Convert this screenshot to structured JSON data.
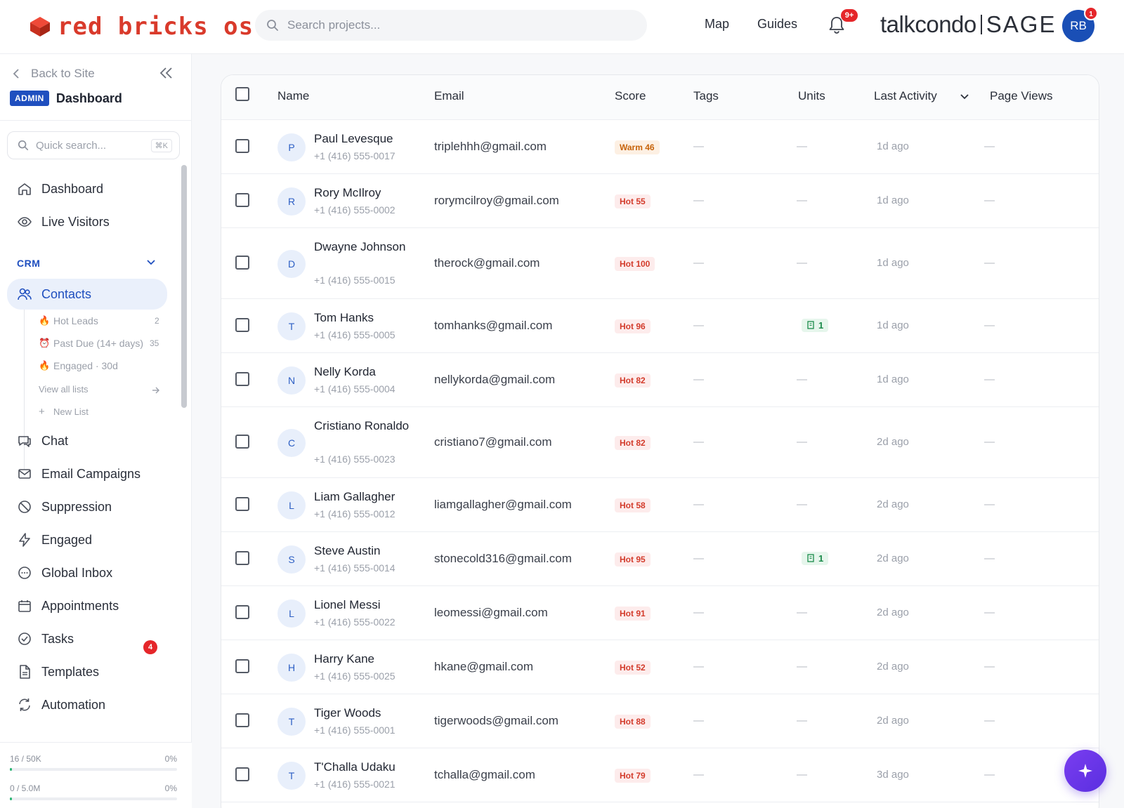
{
  "brand": {
    "name": "red bricks os",
    "partner_left": "talkcondo",
    "partner_right": "SAGE"
  },
  "search": {
    "placeholder": "Search projects..."
  },
  "topnav": {
    "map": "Map",
    "guides": "Guides",
    "notif_badge": "9+",
    "avatar_initials": "RB",
    "avatar_badge": "1"
  },
  "sidebar": {
    "back": "Back to Site",
    "admin_badge": "ADMIN",
    "title": "Dashboard",
    "quick_search_placeholder": "Quick search...",
    "quick_search_shortcut": "⌘K",
    "items_top": [
      {
        "label": "Dashboard",
        "icon": "home-icon"
      },
      {
        "label": "Live Visitors",
        "icon": "eye-icon"
      }
    ],
    "crm_label": "CRM",
    "contacts_label": "Contacts",
    "sublists": [
      {
        "label": "Hot Leads",
        "count": "2",
        "icon": "flame-icon"
      },
      {
        "label": "Past Due (14+ days)",
        "count": "35",
        "icon": "alarm-icon"
      },
      {
        "label": "Engaged · 30d",
        "count": "",
        "icon": "flame-icon"
      }
    ],
    "view_all": "View all lists",
    "new_list": "New List",
    "items_bottom": [
      {
        "label": "Chat",
        "icon": "chat-icon"
      },
      {
        "label": "Email Campaigns",
        "icon": "mail-icon"
      },
      {
        "label": "Suppression",
        "icon": "block-icon"
      },
      {
        "label": "Engaged",
        "icon": "bolt-icon"
      },
      {
        "label": "Global Inbox",
        "icon": "inbox-icon"
      },
      {
        "label": "Appointments",
        "icon": "calendar-icon"
      },
      {
        "label": "Tasks",
        "icon": "check-circle-icon"
      },
      {
        "label": "Templates",
        "icon": "document-icon"
      },
      {
        "label": "Automation",
        "icon": "refresh-icon"
      }
    ],
    "tasks_badge": "4",
    "usage": [
      {
        "label": "16 / 50K",
        "pct": "0%",
        "fill": 0.003
      },
      {
        "label": "0 / 5.0M",
        "pct": "0%",
        "fill": 0.003
      }
    ]
  },
  "table": {
    "headers": {
      "name": "Name",
      "email": "Email",
      "score": "Score",
      "tags": "Tags",
      "units": "Units",
      "last_activity": "Last Activity",
      "page_views": "Page Views"
    },
    "empty": "—",
    "rows": [
      {
        "initial": "P",
        "name": "Paul Levesque",
        "phone": "+1 (416) 555-0017",
        "email": "triplehhh@gmail.com",
        "score": "Warm 46",
        "score_kind": "warm",
        "units": "",
        "activity": "1d ago"
      },
      {
        "initial": "R",
        "name": "Rory McIlroy",
        "phone": "+1 (416) 555-0002",
        "email": "rorymcilroy@gmail.com",
        "score": "Hot 55",
        "score_kind": "hot",
        "units": "",
        "activity": "1d ago"
      },
      {
        "initial": "D",
        "name": "Dwayne Johnson",
        "phone": "+1 (416) 555-0015",
        "email": "therock@gmail.com",
        "score": "Hot 100",
        "score_kind": "hot",
        "units": "",
        "activity": "1d ago"
      },
      {
        "initial": "T",
        "name": "Tom Hanks",
        "phone": "+1 (416) 555-0005",
        "email": "tomhanks@gmail.com",
        "score": "Hot 96",
        "score_kind": "hot",
        "units": "1",
        "activity": "1d ago"
      },
      {
        "initial": "N",
        "name": "Nelly Korda",
        "phone": "+1 (416) 555-0004",
        "email": "nellykorda@gmail.com",
        "score": "Hot 82",
        "score_kind": "hot",
        "units": "",
        "activity": "1d ago"
      },
      {
        "initial": "C",
        "name": "Cristiano Ronaldo",
        "phone": "+1 (416) 555-0023",
        "email": "cristiano7@gmail.com",
        "score": "Hot 82",
        "score_kind": "hot",
        "units": "",
        "activity": "2d ago"
      },
      {
        "initial": "L",
        "name": "Liam Gallagher",
        "phone": "+1 (416) 555-0012",
        "email": "liamgallagher@gmail.com",
        "score": "Hot 58",
        "score_kind": "hot",
        "units": "",
        "activity": "2d ago"
      },
      {
        "initial": "S",
        "name": "Steve Austin",
        "phone": "+1 (416) 555-0014",
        "email": "stonecold316@gmail.com",
        "score": "Hot 95",
        "score_kind": "hot",
        "units": "1",
        "activity": "2d ago"
      },
      {
        "initial": "L",
        "name": "Lionel Messi",
        "phone": "+1 (416) 555-0022",
        "email": "leomessi@gmail.com",
        "score": "Hot 91",
        "score_kind": "hot",
        "units": "",
        "activity": "2d ago"
      },
      {
        "initial": "H",
        "name": "Harry Kane",
        "phone": "+1 (416) 555-0025",
        "email": "hkane@gmail.com",
        "score": "Hot 52",
        "score_kind": "hot",
        "units": "",
        "activity": "2d ago"
      },
      {
        "initial": "T",
        "name": "Tiger Woods",
        "phone": "+1 (416) 555-0001",
        "email": "tigerwoods@gmail.com",
        "score": "Hot 88",
        "score_kind": "hot",
        "units": "",
        "activity": "2d ago"
      },
      {
        "initial": "T",
        "name": "T'Challa Udaku",
        "phone": "+1 (416) 555-0021",
        "email": "tchalla@gmail.com",
        "score": "Hot 79",
        "score_kind": "hot",
        "units": "",
        "activity": "3d ago"
      }
    ]
  },
  "colors": {
    "brand_red": "#d93a2b",
    "accent_blue": "#1f4fbf",
    "fab_purple": "#6a35e8",
    "hot": "#d33b2b",
    "warm": "#c7630a",
    "units_green": "#1a8a4a"
  }
}
